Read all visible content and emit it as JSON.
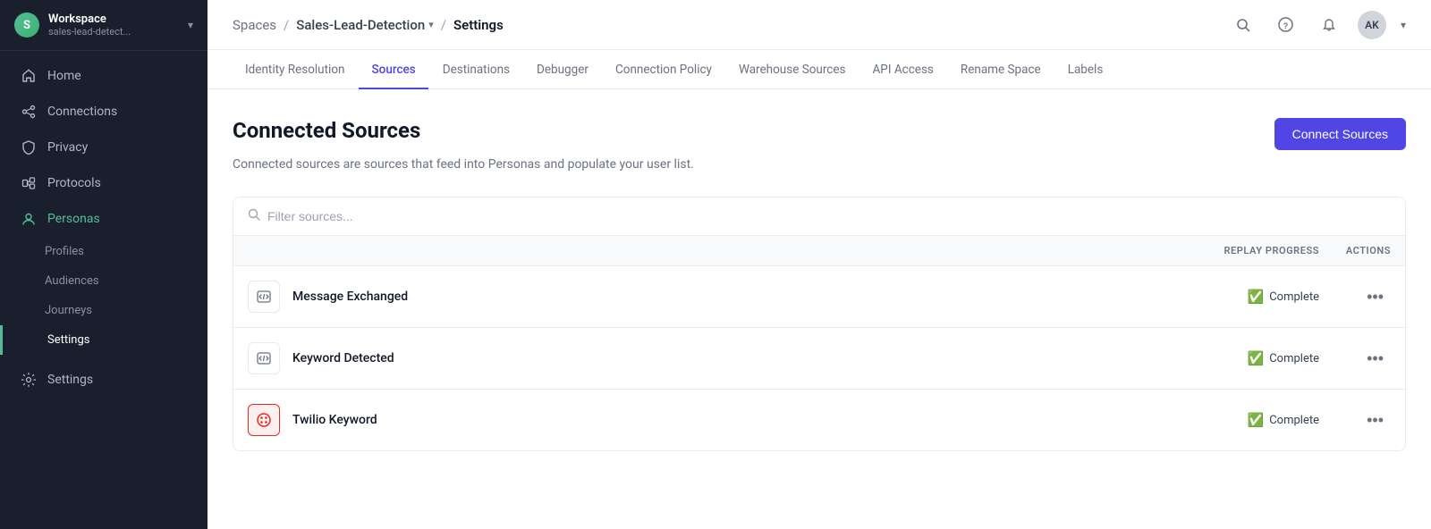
{
  "workspace": {
    "logo_text": "S",
    "name": "Workspace",
    "sub": "sales-lead-detect...",
    "chevron": "▾"
  },
  "sidebar": {
    "nav_items": [
      {
        "id": "home",
        "label": "Home",
        "icon": "home"
      },
      {
        "id": "connections",
        "label": "Connections",
        "icon": "connections"
      },
      {
        "id": "privacy",
        "label": "Privacy",
        "icon": "privacy"
      },
      {
        "id": "protocols",
        "label": "Protocols",
        "icon": "protocols"
      },
      {
        "id": "personas",
        "label": "Personas",
        "icon": "personas",
        "active": true
      },
      {
        "id": "settings-bottom",
        "label": "Settings",
        "icon": "settings"
      }
    ],
    "sub_items": [
      {
        "id": "profiles",
        "label": "Profiles"
      },
      {
        "id": "audiences",
        "label": "Audiences"
      },
      {
        "id": "journeys",
        "label": "Journeys"
      },
      {
        "id": "settings-sub",
        "label": "Settings",
        "active": true
      }
    ]
  },
  "header": {
    "breadcrumb": {
      "spaces": "Spaces",
      "space_name": "Sales-Lead-Detection",
      "current": "Settings"
    },
    "avatar": "AK"
  },
  "tabs": [
    {
      "id": "identity-resolution",
      "label": "Identity Resolution"
    },
    {
      "id": "sources",
      "label": "Sources",
      "active": true
    },
    {
      "id": "destinations",
      "label": "Destinations"
    },
    {
      "id": "debugger",
      "label": "Debugger"
    },
    {
      "id": "connection-policy",
      "label": "Connection Policy"
    },
    {
      "id": "warehouse-sources",
      "label": "Warehouse Sources"
    },
    {
      "id": "api-access",
      "label": "API Access"
    },
    {
      "id": "rename-space",
      "label": "Rename Space"
    },
    {
      "id": "labels",
      "label": "Labels"
    }
  ],
  "page": {
    "title": "Connected Sources",
    "description": "Connected sources are sources that feed into Personas and populate your user list.",
    "connect_button": "Connect Sources",
    "filter_placeholder": "Filter sources...",
    "columns": {
      "replay_progress": "REPLAY PROGRESS",
      "actions": "ACTIONS"
    },
    "sources": [
      {
        "id": "message-exchanged",
        "name": "Message Exchanged",
        "icon": "code",
        "status": "Complete",
        "type": "generic"
      },
      {
        "id": "keyword-detected",
        "name": "Keyword Detected",
        "icon": "code",
        "status": "Complete",
        "type": "generic"
      },
      {
        "id": "twilio-keyword",
        "name": "Twilio Keyword",
        "icon": "twilio",
        "status": "Complete",
        "type": "twilio"
      }
    ]
  }
}
